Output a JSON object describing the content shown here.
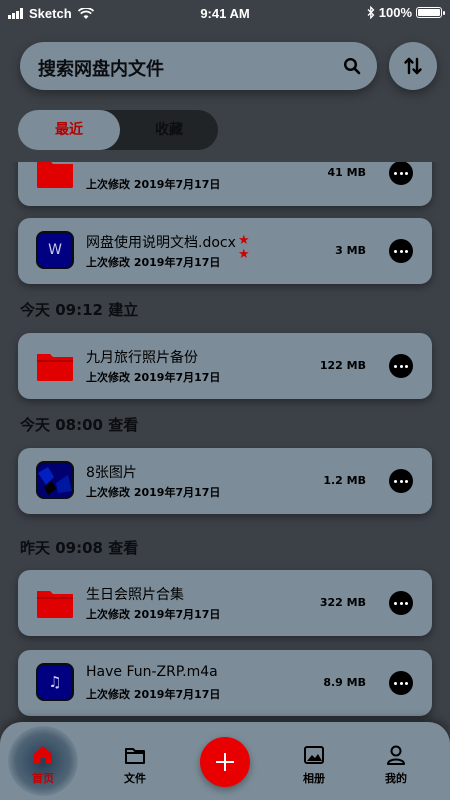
{
  "status_bar": {
    "carrier": "Sketch",
    "time": "9:41 AM",
    "battery": "100%",
    "battery_level": 1.0
  },
  "search": {
    "placeholder": "搜索网盘内文件",
    "icon": "search-icon"
  },
  "sort_button": {
    "icon": "sort-arrows-icon"
  },
  "segment": {
    "recent": "最近",
    "favorites": "收藏"
  },
  "files": [
    {
      "name": "",
      "meta": "上次修改 2019年7月17日",
      "size": "41 MB",
      "type": "folder"
    },
    {
      "name": "网盘使用说明文档.docx",
      "meta": "上次修改 2019年7月17日",
      "size": "3 MB",
      "type": "doc",
      "thumb_letter": "W",
      "starred": true
    },
    {
      "name": "九月旅行照片备份",
      "meta": "上次修改 2019年7月17日",
      "size": "122 MB",
      "type": "folder"
    },
    {
      "name": "8张图片",
      "meta": "上次修改 2019年7月17日",
      "size": "1.2 MB",
      "type": "photo"
    },
    {
      "name": "生日会照片合集",
      "meta": "上次修改 2019年7月17日",
      "size": "322 MB",
      "type": "folder"
    },
    {
      "name": "Have Fun-ZRP.m4a",
      "meta": "上次修改 2019年7月17日",
      "size": "8.9 MB",
      "type": "audio",
      "thumb_glyph": "♫"
    }
  ],
  "sections": [
    "今天 09:12  建立",
    "今天 08:00  查看",
    "昨天 09:08  查看"
  ],
  "tabbar": {
    "home": "首页",
    "files": "文件",
    "album": "相册",
    "mine": "我的"
  },
  "colors": {
    "background": "#3c4147",
    "card": "#7c8d99",
    "accent_red": "#e80000",
    "folder_red": "#e00000",
    "doc_blue": "#000080"
  }
}
